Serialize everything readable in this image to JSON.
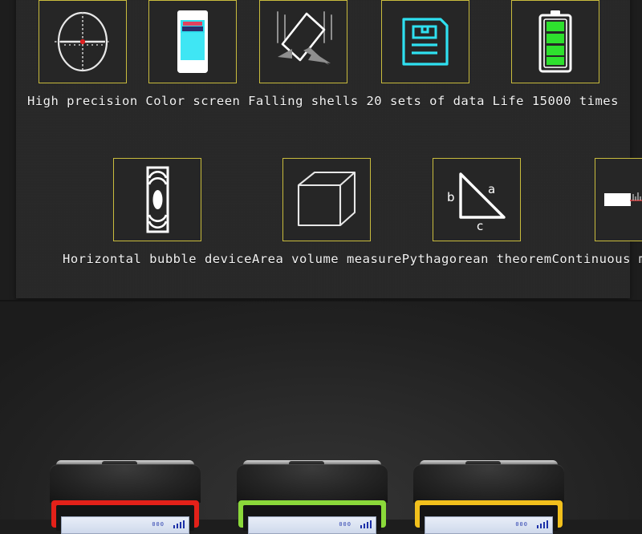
{
  "panel": {
    "background_color": "#262626",
    "box_border_color": "#c9bc3d",
    "label_color": "#f2f2f2"
  },
  "features": {
    "row_top": [
      {
        "id": "high-precision",
        "icon": "crosshair-reticle-icon",
        "label": "High precision",
        "accent": "#e02020"
      },
      {
        "id": "color-screen",
        "icon": "color-screen-icon",
        "label": "Color screen",
        "accent": "#2fe0f0"
      },
      {
        "id": "falling-shells",
        "icon": "falling-device-icon",
        "label": "Falling shells",
        "accent": "#9a9a9a"
      },
      {
        "id": "sets-of-data",
        "icon": "data-document-icon",
        "label": "20 sets of data",
        "accent": "#2fe0f0"
      },
      {
        "id": "battery-life",
        "icon": "battery-icon",
        "label": "Life 15000 times",
        "accent": "#2ee02e"
      }
    ],
    "row_bottom": [
      {
        "id": "bubble-level",
        "icon": "bubble-level-icon",
        "label": "Horizontal bubble device",
        "accent": "#ffffff"
      },
      {
        "id": "area-volume",
        "icon": "wireframe-cube-icon",
        "label": "Area volume measure",
        "accent": "#ffffff"
      },
      {
        "id": "pythagorean",
        "icon": "right-triangle-icon",
        "label": "Pythagorean theorem",
        "accent": "#ffffff"
      },
      {
        "id": "continuous",
        "icon": "laser-ruler-icon",
        "label": "Continuous measurement",
        "accent": "#d83a3a"
      }
    ]
  },
  "triangle_labels": {
    "hypotenuse": "a",
    "vertical": "b",
    "base": "c"
  },
  "devices": [
    {
      "id": "device-red",
      "accent_color": "#e32119",
      "screen_text": "000"
    },
    {
      "id": "device-green",
      "accent_color": "#8bd93a",
      "screen_text": "000"
    },
    {
      "id": "device-yellow",
      "accent_color": "#f2c01c",
      "screen_text": "000"
    }
  ]
}
